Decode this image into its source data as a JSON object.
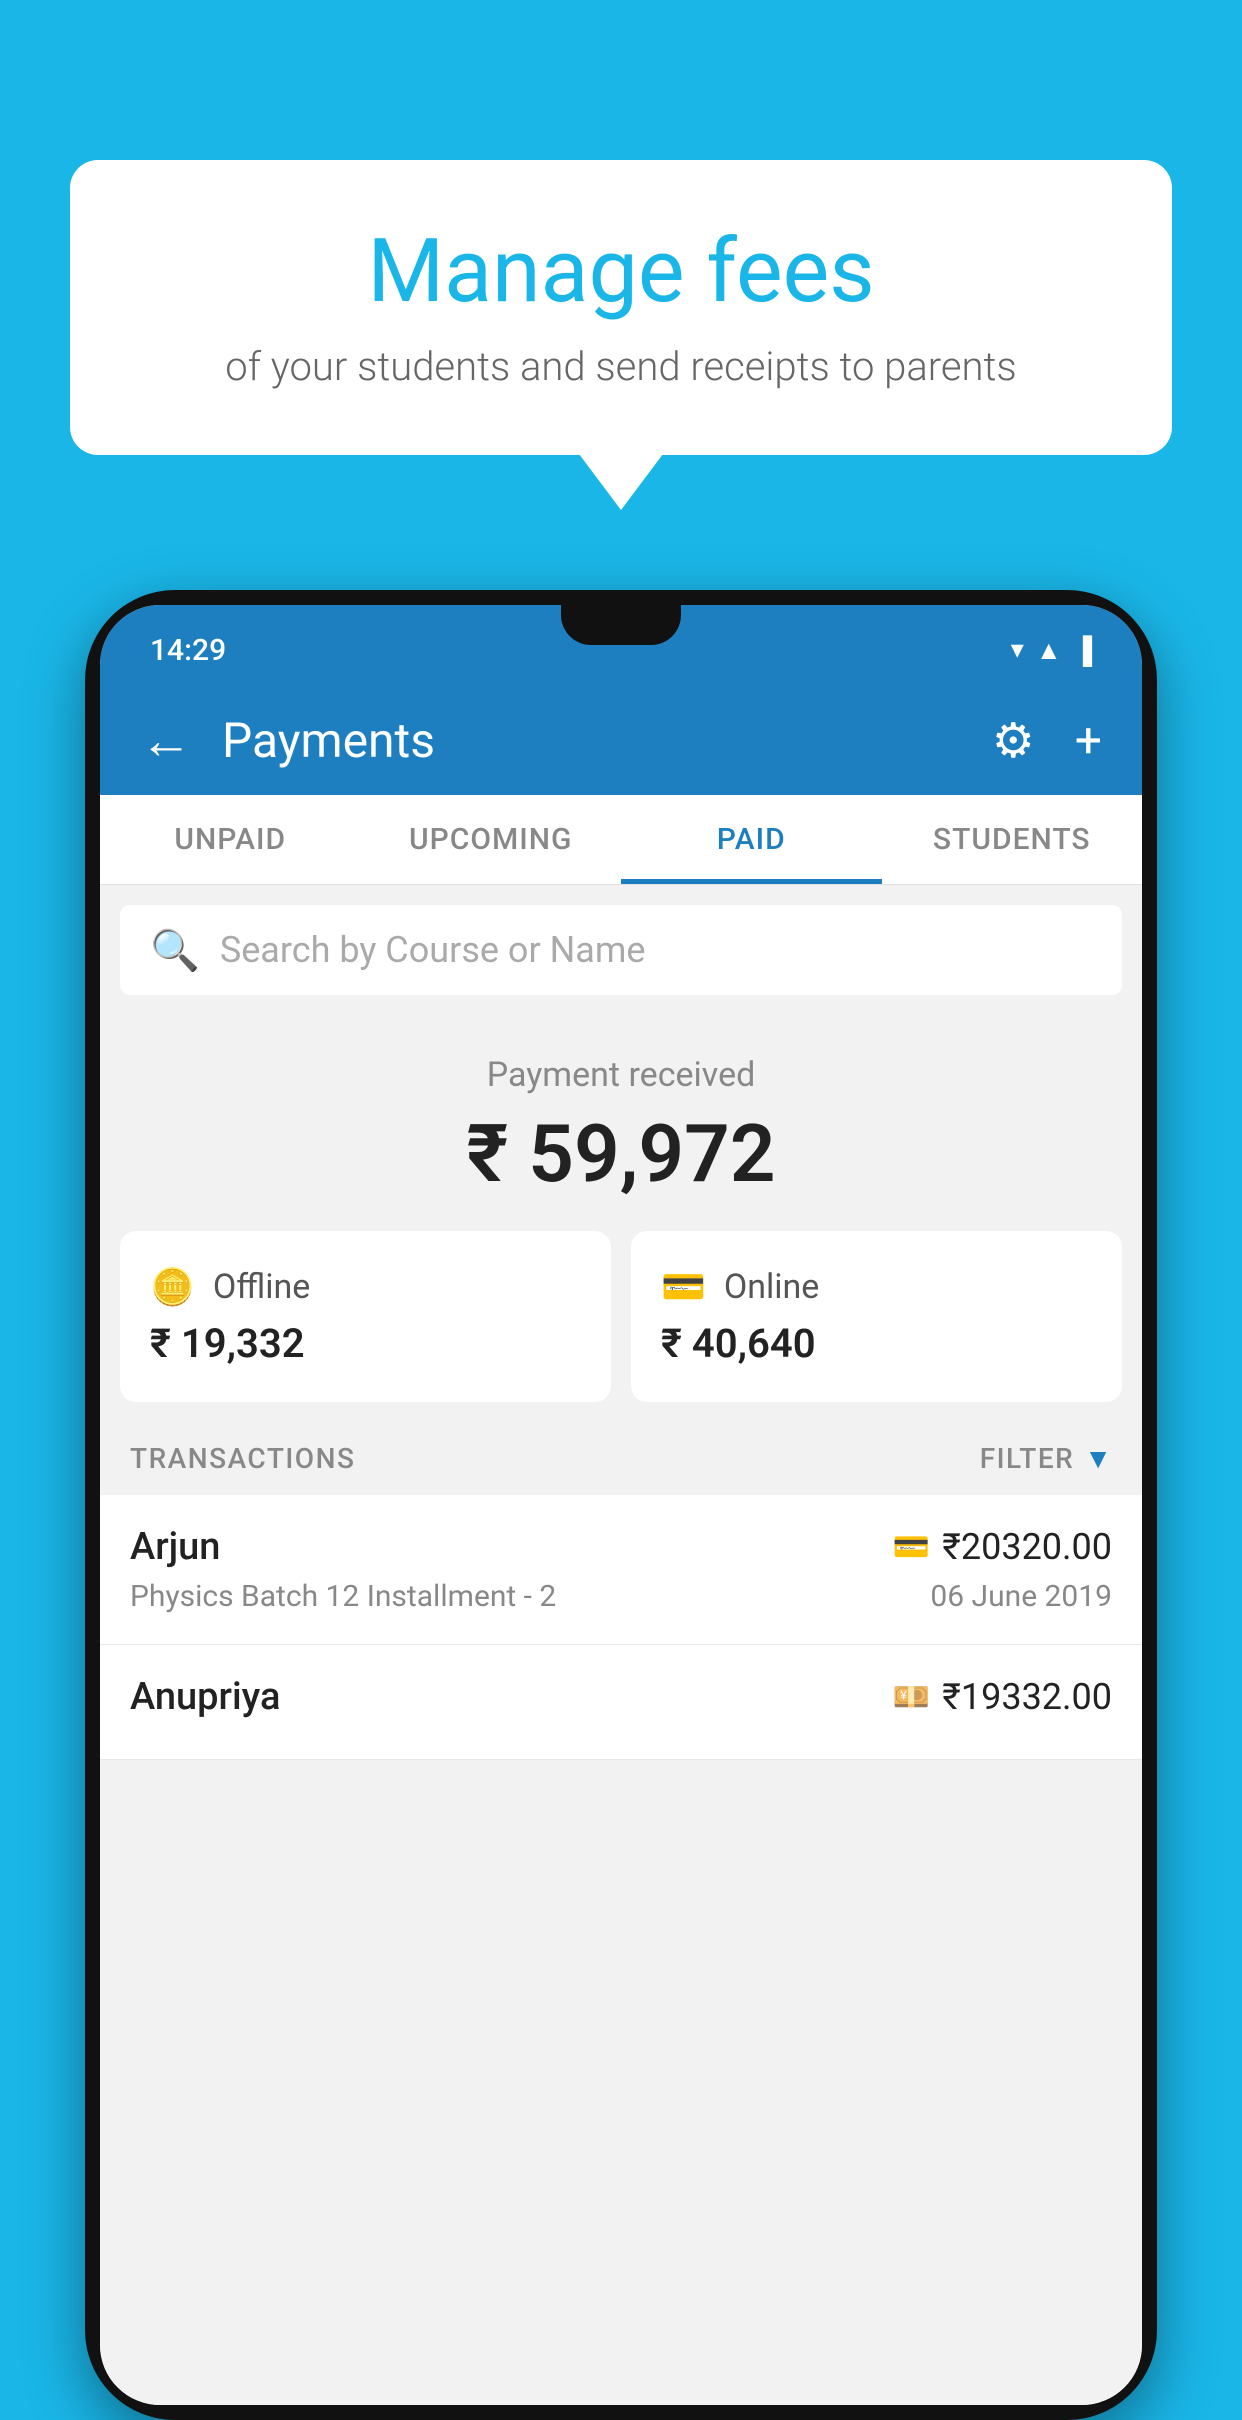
{
  "background_color": "#1ab6e8",
  "bubble": {
    "title": "Manage fees",
    "subtitle": "of your students and send receipts to parents"
  },
  "phone": {
    "status_bar": {
      "time": "14:29"
    },
    "header": {
      "title": "Payments",
      "back_label": "←",
      "settings_label": "⚙",
      "add_label": "+"
    },
    "tabs": [
      {
        "label": "UNPAID",
        "active": false
      },
      {
        "label": "UPCOMING",
        "active": false
      },
      {
        "label": "PAID",
        "active": true
      },
      {
        "label": "STUDENTS",
        "active": false
      }
    ],
    "search": {
      "placeholder": "Search by Course or Name"
    },
    "payment_summary": {
      "label": "Payment received",
      "amount": "₹ 59,972"
    },
    "cards": [
      {
        "icon": "💳",
        "label": "Offline",
        "amount": "₹ 19,332"
      },
      {
        "icon": "💳",
        "label": "Online",
        "amount": "₹ 40,640"
      }
    ],
    "transactions_label": "TRANSACTIONS",
    "filter_label": "FILTER",
    "transactions": [
      {
        "name": "Arjun",
        "amount": "₹20320.00",
        "course": "Physics Batch 12 Installment - 2",
        "date": "06 June 2019",
        "icon": "💳"
      },
      {
        "name": "Anupriya",
        "amount": "₹19332.00",
        "course": "",
        "date": "",
        "icon": "💴"
      }
    ]
  }
}
